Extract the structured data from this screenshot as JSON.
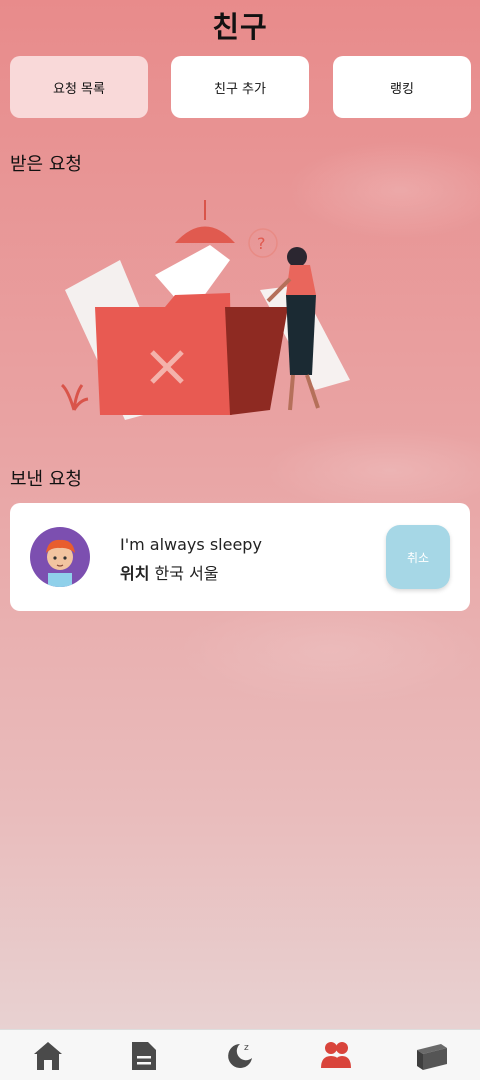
{
  "header": {
    "title": "친구"
  },
  "tabs": [
    {
      "label": "요청 목록",
      "active": true
    },
    {
      "label": "친구 추가",
      "active": false
    },
    {
      "label": "랭킹",
      "active": false
    }
  ],
  "received": {
    "title": "받은 요청"
  },
  "sent": {
    "title": "보낸 요청",
    "items": [
      {
        "status_message": "I'm always sleepy",
        "location_label": "위치",
        "location_value": "한국 서울",
        "cancel_label": "취소"
      }
    ]
  },
  "bottom_nav": [
    {
      "icon": "home-icon",
      "label": ""
    },
    {
      "icon": "document-icon",
      "label": ""
    },
    {
      "icon": "sleep-icon",
      "label": ""
    },
    {
      "icon": "friends-icon",
      "label": "",
      "active": true
    },
    {
      "icon": "box-icon",
      "label": ""
    }
  ],
  "colors": {
    "accent": "#e05a4f",
    "active_tab": "#f9d9d9",
    "cancel_button": "#a6d7e6"
  }
}
